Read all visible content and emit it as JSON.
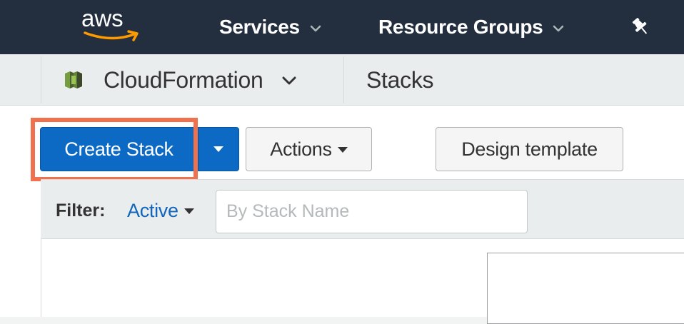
{
  "top_nav": {
    "logo_text": "aws",
    "services_label": "Services",
    "resource_groups_label": "Resource Groups",
    "pin_icon": "pin-icon",
    "dropdown_icon": "chevron-down-icon"
  },
  "service_bar": {
    "service_name": "CloudFormation",
    "service_icon": "cloudformation-icon",
    "breadcrumb": "Stacks"
  },
  "toolbar": {
    "create_stack_label": "Create Stack",
    "actions_label": "Actions",
    "design_template_label": "Design template"
  },
  "filter": {
    "label": "Filter:",
    "selected_value": "Active",
    "search_placeholder": "By Stack Name",
    "search_value": ""
  },
  "colors": {
    "nav_background": "#232f3e",
    "primary_button": "#0c6ac4",
    "link": "#1166bb",
    "highlight": "#f0714e",
    "aws_smile": "#f90"
  }
}
